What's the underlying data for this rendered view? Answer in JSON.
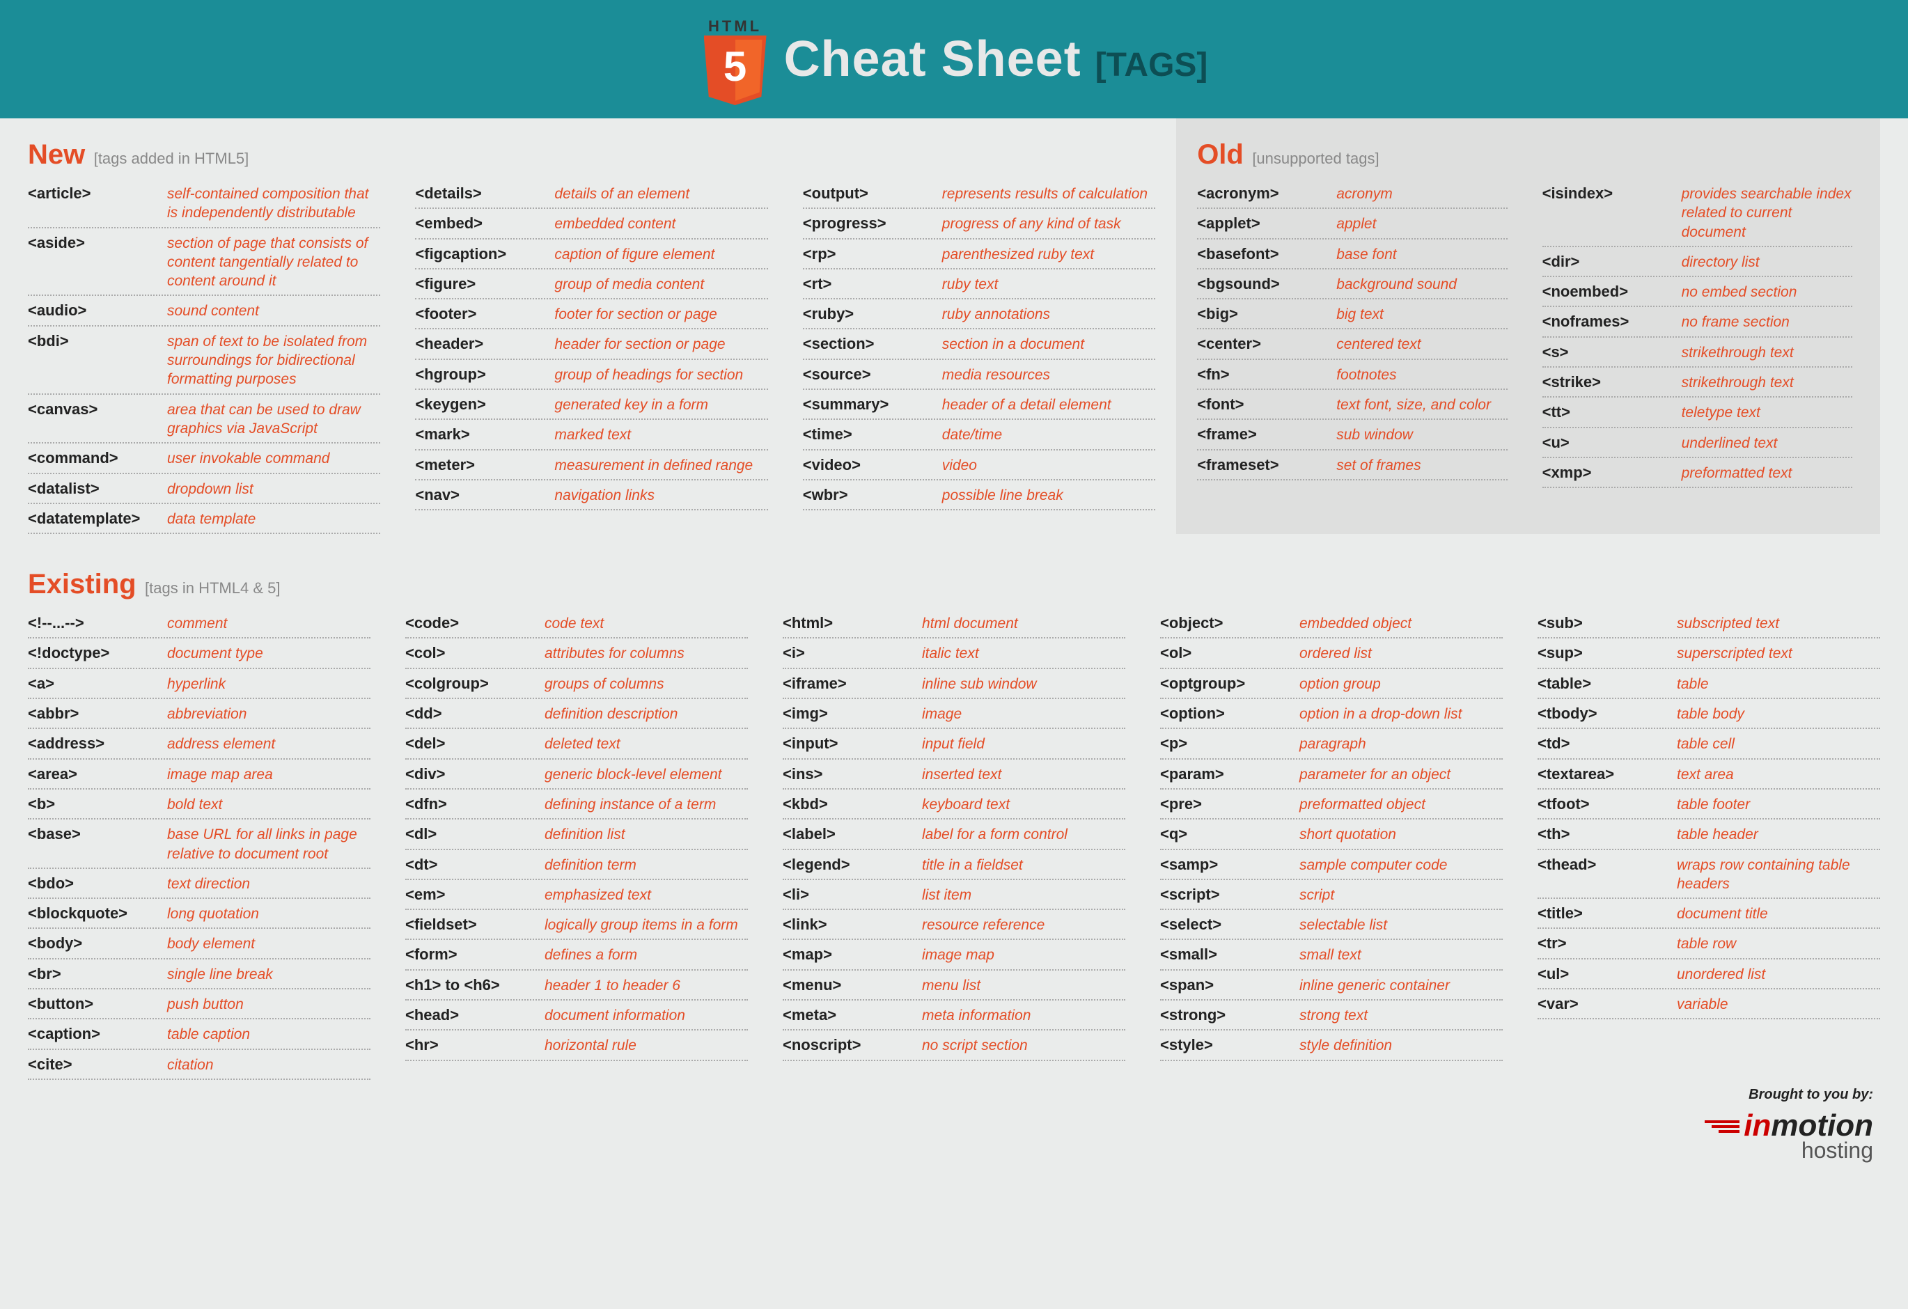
{
  "header": {
    "logo_text": "HTML",
    "logo_num": "5",
    "title": "Cheat Sheet",
    "badge": "[TAGS]"
  },
  "sections": {
    "new": {
      "title": "New",
      "sub": "[tags added in HTML5]"
    },
    "old": {
      "title": "Old",
      "sub": "[unsupported tags]"
    },
    "existing": {
      "title": "Existing",
      "sub": "[tags in HTML4 & 5]"
    }
  },
  "new": [
    [
      {
        "t": "<article>",
        "d": "self-contained composition that is independently distributable"
      },
      {
        "t": "<aside>",
        "d": "section of page that consists of content tangentially related to content around it"
      },
      {
        "t": "<audio>",
        "d": "sound content"
      },
      {
        "t": "<bdi>",
        "d": "span of text to be isolated from surroundings for bidirectional formatting purposes"
      },
      {
        "t": "<canvas>",
        "d": "area that can be used to draw graphics via JavaScript"
      },
      {
        "t": "<command>",
        "d": "user invokable command"
      },
      {
        "t": "<datalist>",
        "d": "dropdown list"
      },
      {
        "t": "<datatemplate>",
        "d": "data template"
      }
    ],
    [
      {
        "t": "<details>",
        "d": "details of an element"
      },
      {
        "t": "<embed>",
        "d": "embedded content"
      },
      {
        "t": "<figcaption>",
        "d": "caption of figure element"
      },
      {
        "t": "<figure>",
        "d": "group of media content"
      },
      {
        "t": "<footer>",
        "d": "footer for section or page"
      },
      {
        "t": "<header>",
        "d": "header for section or page"
      },
      {
        "t": "<hgroup>",
        "d": "group of headings for section"
      },
      {
        "t": "<keygen>",
        "d": "generated key in a form"
      },
      {
        "t": "<mark>",
        "d": "marked text"
      },
      {
        "t": "<meter>",
        "d": "measurement in defined range"
      },
      {
        "t": "<nav>",
        "d": "navigation links"
      }
    ],
    [
      {
        "t": "<output>",
        "d": "represents results of calculation"
      },
      {
        "t": "<progress>",
        "d": "progress of any kind of task"
      },
      {
        "t": "<rp>",
        "d": "parenthesized ruby text"
      },
      {
        "t": "<rt>",
        "d": "ruby text"
      },
      {
        "t": "<ruby>",
        "d": "ruby annotations"
      },
      {
        "t": "<section>",
        "d": "section in a document"
      },
      {
        "t": "<source>",
        "d": "media resources"
      },
      {
        "t": "<summary>",
        "d": "header of a detail element"
      },
      {
        "t": "<time>",
        "d": "date/time"
      },
      {
        "t": "<video>",
        "d": "video"
      },
      {
        "t": "<wbr>",
        "d": "possible line break"
      }
    ]
  ],
  "old": [
    [
      {
        "t": "<acronym>",
        "d": "acronym"
      },
      {
        "t": "<applet>",
        "d": "applet"
      },
      {
        "t": "<basefont>",
        "d": "base font"
      },
      {
        "t": "<bgsound>",
        "d": "background sound"
      },
      {
        "t": "<big>",
        "d": "big text"
      },
      {
        "t": "<center>",
        "d": "centered text"
      },
      {
        "t": "<fn>",
        "d": "footnotes"
      },
      {
        "t": "<font>",
        "d": "text font, size, and color"
      },
      {
        "t": "<frame>",
        "d": "sub window"
      },
      {
        "t": "<frameset>",
        "d": "set of frames"
      }
    ],
    [
      {
        "t": "<isindex>",
        "d": "provides searchable index related to current document"
      },
      {
        "t": "<dir>",
        "d": "directory list"
      },
      {
        "t": "<noembed>",
        "d": "no embed section"
      },
      {
        "t": "<noframes>",
        "d": "no frame section"
      },
      {
        "t": "<s>",
        "d": "strikethrough text"
      },
      {
        "t": "<strike>",
        "d": "strikethrough text"
      },
      {
        "t": "<tt>",
        "d": "teletype text"
      },
      {
        "t": "<u>",
        "d": "underlined text"
      },
      {
        "t": "<xmp>",
        "d": "preformatted text"
      }
    ]
  ],
  "existing": [
    [
      {
        "t": "<!--...-->",
        "d": "comment"
      },
      {
        "t": "<!doctype>",
        "d": "document type"
      },
      {
        "t": "<a>",
        "d": "hyperlink"
      },
      {
        "t": "<abbr>",
        "d": "abbreviation"
      },
      {
        "t": "<address>",
        "d": "address element"
      },
      {
        "t": "<area>",
        "d": "image map area"
      },
      {
        "t": "<b>",
        "d": "bold text"
      },
      {
        "t": "<base>",
        "d": "base URL for all links in page relative to document root"
      },
      {
        "t": "<bdo>",
        "d": "text direction"
      },
      {
        "t": "<blockquote>",
        "d": "long quotation"
      },
      {
        "t": "<body>",
        "d": "body element"
      },
      {
        "t": "<br>",
        "d": "single line break"
      },
      {
        "t": "<button>",
        "d": "push button"
      },
      {
        "t": "<caption>",
        "d": "table caption"
      },
      {
        "t": "<cite>",
        "d": "citation"
      }
    ],
    [
      {
        "t": "<code>",
        "d": "code text"
      },
      {
        "t": "<col>",
        "d": "attributes for columns"
      },
      {
        "t": "<colgroup>",
        "d": "groups of columns"
      },
      {
        "t": "<dd>",
        "d": "definition description"
      },
      {
        "t": "<del>",
        "d": "deleted text"
      },
      {
        "t": "<div>",
        "d": "generic block-level element"
      },
      {
        "t": "<dfn>",
        "d": "defining instance of a term"
      },
      {
        "t": "<dl>",
        "d": "definition list"
      },
      {
        "t": "<dt>",
        "d": "definition term"
      },
      {
        "t": "<em>",
        "d": "emphasized text"
      },
      {
        "t": "<fieldset>",
        "d": "logically group items in a form"
      },
      {
        "t": "<form>",
        "d": "defines a form"
      },
      {
        "t": "<h1> to <h6>",
        "d": "header 1 to header 6"
      },
      {
        "t": "<head>",
        "d": "document information"
      },
      {
        "t": "<hr>",
        "d": "horizontal rule"
      }
    ],
    [
      {
        "t": "<html>",
        "d": "html document"
      },
      {
        "t": "<i>",
        "d": "italic text"
      },
      {
        "t": "<iframe>",
        "d": "inline sub window"
      },
      {
        "t": "<img>",
        "d": "image"
      },
      {
        "t": "<input>",
        "d": "input field"
      },
      {
        "t": "<ins>",
        "d": "inserted text"
      },
      {
        "t": "<kbd>",
        "d": "keyboard text"
      },
      {
        "t": "<label>",
        "d": "label for a form control"
      },
      {
        "t": "<legend>",
        "d": "title in a fieldset"
      },
      {
        "t": "<li>",
        "d": "list item"
      },
      {
        "t": "<link>",
        "d": "resource reference"
      },
      {
        "t": "<map>",
        "d": "image map"
      },
      {
        "t": "<menu>",
        "d": "menu list"
      },
      {
        "t": "<meta>",
        "d": "meta information"
      },
      {
        "t": "<noscript>",
        "d": "no script section"
      }
    ],
    [
      {
        "t": "<object>",
        "d": "embedded object"
      },
      {
        "t": "<ol>",
        "d": "ordered list"
      },
      {
        "t": "<optgroup>",
        "d": "option group"
      },
      {
        "t": "<option>",
        "d": "option in a drop-down list"
      },
      {
        "t": "<p>",
        "d": "paragraph"
      },
      {
        "t": "<param>",
        "d": "parameter for an object"
      },
      {
        "t": "<pre>",
        "d": "preformatted object"
      },
      {
        "t": "<q>",
        "d": "short quotation"
      },
      {
        "t": "<samp>",
        "d": "sample computer code"
      },
      {
        "t": "<script>",
        "d": "script"
      },
      {
        "t": "<select>",
        "d": "selectable list"
      },
      {
        "t": "<small>",
        "d": "small text"
      },
      {
        "t": "<span>",
        "d": "inline generic container"
      },
      {
        "t": "<strong>",
        "d": "strong text"
      },
      {
        "t": "<style>",
        "d": "style definition"
      }
    ],
    [
      {
        "t": "<sub>",
        "d": "subscripted text"
      },
      {
        "t": "<sup>",
        "d": "superscripted text"
      },
      {
        "t": "<table>",
        "d": "table"
      },
      {
        "t": "<tbody>",
        "d": "table body"
      },
      {
        "t": "<td>",
        "d": "table cell"
      },
      {
        "t": "<textarea>",
        "d": "text area"
      },
      {
        "t": "<tfoot>",
        "d": "table footer"
      },
      {
        "t": "<th>",
        "d": "table header"
      },
      {
        "t": "<thead>",
        "d": "wraps row containing table headers"
      },
      {
        "t": "<title>",
        "d": "document title"
      },
      {
        "t": "<tr>",
        "d": "table row"
      },
      {
        "t": "<ul>",
        "d": "unordered list"
      },
      {
        "t": "<var>",
        "d": "variable"
      }
    ]
  ],
  "footer": {
    "brought": "Brought to you by:",
    "brand_in": "in",
    "brand_motion": "motion",
    "brand_hosting": "hosting"
  }
}
